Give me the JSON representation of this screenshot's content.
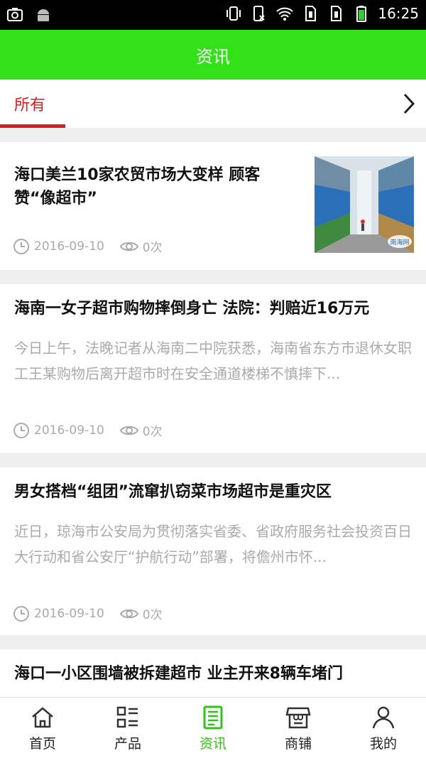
{
  "status_bar": {
    "time": "16:25"
  },
  "app_bar": {
    "title": "资讯"
  },
  "tabs": {
    "active": "所有"
  },
  "articles": [
    {
      "title": "海口美兰10家农贸市场大变样 顾客赞“像超市”",
      "date": "2016-09-10",
      "views": "0次",
      "thumbnail_watermark": "南海网"
    },
    {
      "title": "海南一女子超市购物摔倒身亡 法院：判赔近16万元",
      "summary": "今日上午，法晚记者从海南二中院获悉，海南省东方市退休女职工王某购物后离开超市时在安全通道楼梯不慎摔下...",
      "date": "2016-09-10",
      "views": "0次"
    },
    {
      "title": "男女搭档“组团”流窜扒窃菜市场超市是重灾区",
      "summary": "近日，琼海市公安局为贯彻落实省委、省政府服务社会投资百日大行动和省公安厅“护航行动”部署，将儋州市怀...",
      "date": "2016-09-10",
      "views": "0次"
    },
    {
      "title": "海口一小区围墙被拆建超市 业主开来8辆车堵门"
    }
  ],
  "bottom_nav": [
    {
      "label": "首页",
      "icon": "home-icon"
    },
    {
      "label": "产品",
      "icon": "list-icon"
    },
    {
      "label": "资讯",
      "icon": "news-icon",
      "active": true
    },
    {
      "label": "商铺",
      "icon": "store-icon"
    },
    {
      "label": "我的",
      "icon": "user-icon"
    }
  ],
  "colors": {
    "accent_green": "#33e118",
    "tab_red": "#d42020",
    "meta_gray": "#aaaaaa"
  }
}
